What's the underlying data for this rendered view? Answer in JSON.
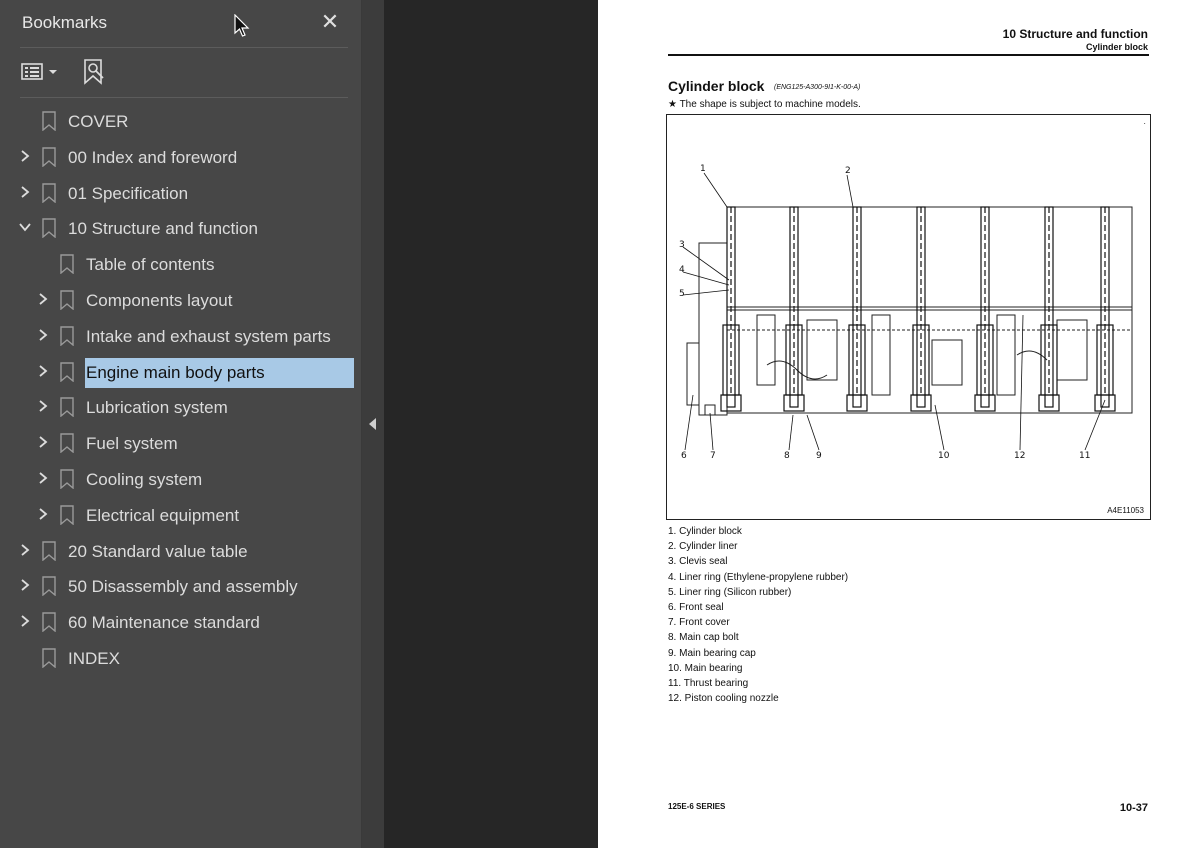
{
  "sidebar": {
    "title": "Bookmarks",
    "close_label": "✕",
    "items": [
      {
        "label": "COVER",
        "level": 0,
        "expander": "none"
      },
      {
        "label": "00 Index and foreword",
        "level": 0,
        "expander": "collapsed"
      },
      {
        "label": "01 Specification",
        "level": 0,
        "expander": "collapsed"
      },
      {
        "label": "10 Structure and function",
        "level": 0,
        "expander": "expanded"
      },
      {
        "label": "Table of contents",
        "level": 1,
        "expander": "none"
      },
      {
        "label": "Components layout",
        "level": 1,
        "expander": "collapsed"
      },
      {
        "label": "Intake and exhaust system parts",
        "level": 1,
        "expander": "collapsed"
      },
      {
        "label": "Engine main body parts",
        "level": 1,
        "expander": "collapsed",
        "selected": true
      },
      {
        "label": "Lubrication system",
        "level": 1,
        "expander": "collapsed"
      },
      {
        "label": "Fuel system",
        "level": 1,
        "expander": "collapsed"
      },
      {
        "label": "Cooling system",
        "level": 1,
        "expander": "collapsed"
      },
      {
        "label": "Electrical equipment",
        "level": 1,
        "expander": "collapsed"
      },
      {
        "label": "20 Standard value table",
        "level": 0,
        "expander": "collapsed"
      },
      {
        "label": "50 Disassembly and assembly",
        "level": 0,
        "expander": "collapsed"
      },
      {
        "label": "60 Maintenance standard",
        "level": 0,
        "expander": "collapsed"
      },
      {
        "label": "INDEX",
        "level": 0,
        "expander": "none"
      }
    ]
  },
  "document": {
    "header_main": "10 Structure and function",
    "header_sub": "Cylinder block",
    "title": "Cylinder block",
    "code": "(ENG125-A300-9I1-K-00-A)",
    "note": "★  The shape is subject to machine models.",
    "figure_code": "A4E11053",
    "figure_callouts": [
      "1",
      "2",
      "3",
      "4",
      "5",
      "6",
      "7",
      "8",
      "9",
      "10",
      "12",
      "11"
    ],
    "parts": [
      "1. Cylinder block",
      "2. Cylinder liner",
      "3. Clevis seal",
      "4. Liner ring (Ethylene-propylene rubber)",
      "5. Liner ring (Silicon rubber)",
      "6. Front seal",
      "7. Front cover",
      "8. Main cap bolt",
      "9. Main bearing cap",
      "10. Main bearing",
      "11. Thrust bearing",
      "12. Piston cooling nozzle"
    ],
    "footer_left": "125E-6 SERIES",
    "footer_right": "10-37"
  },
  "colors": {
    "sidebar_bg": "#474747",
    "selection": "#a8c9e6",
    "viewer_bg": "#262626"
  }
}
